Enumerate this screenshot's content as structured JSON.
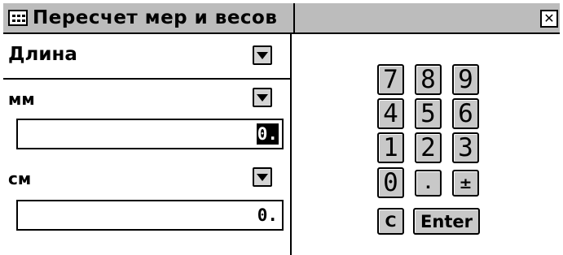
{
  "window": {
    "title": "Пересчет мер и весов",
    "close_glyph": "✕",
    "icon": "keypad-window-icon"
  },
  "category": {
    "value": "Длина"
  },
  "units": [
    {
      "label": "мм",
      "value": "0."
    },
    {
      "label": "см",
      "value": "0."
    }
  ],
  "keypad": {
    "rows": [
      [
        "7",
        "8",
        "9"
      ],
      [
        "4",
        "5",
        "6"
      ],
      [
        "1",
        "2",
        "3"
      ],
      [
        "0",
        ".",
        "±"
      ]
    ],
    "clear": "C",
    "enter": "Enter"
  },
  "colors": {
    "titlebar": "#bcbcbc",
    "key_face": "#c8c8c8",
    "background": "#ffffff"
  }
}
